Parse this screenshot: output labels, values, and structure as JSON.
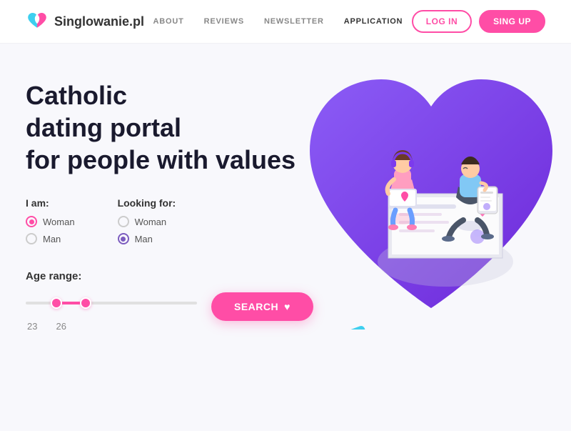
{
  "header": {
    "logo_text": "Singlowanie.pl",
    "nav": {
      "items": [
        {
          "label": "ABOUT",
          "active": false
        },
        {
          "label": "REVIEWS",
          "active": false
        },
        {
          "label": "NEWSLETTER",
          "active": false
        },
        {
          "label": "APPLICATION",
          "active": true
        }
      ]
    },
    "login_label": "LOG IN",
    "signup_label": "SING UP"
  },
  "hero": {
    "title_line1": "Catholic",
    "title_line2": "dating portal",
    "title_line3": "for people with values"
  },
  "iam": {
    "label": "I am:",
    "options": [
      {
        "label": "Woman",
        "selected": true
      },
      {
        "label": "Man",
        "selected": false
      }
    ]
  },
  "looking_for": {
    "label": "Looking for:",
    "options": [
      {
        "label": "Woman",
        "selected": false
      },
      {
        "label": "Man",
        "selected": true
      }
    ]
  },
  "age_range": {
    "label": "Age range:",
    "min": 23,
    "max": 26
  },
  "search": {
    "label": "SEARCH"
  },
  "colors": {
    "pink": "#ff4da6",
    "purple": "#7c3aed",
    "purple_heart": "#6d28d9",
    "blue": "#3ecfef"
  }
}
